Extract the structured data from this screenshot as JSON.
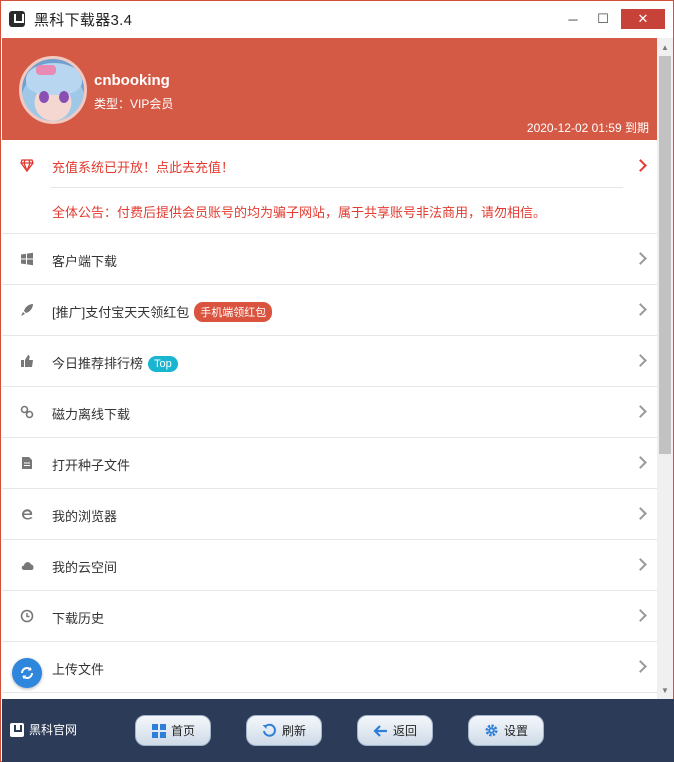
{
  "window": {
    "title": "黑科下载器3.4",
    "controls": {
      "minimize": "─",
      "maximize": "☐",
      "close": "✕"
    }
  },
  "profile": {
    "username": "cnbooking",
    "type": "类型：VIP会员",
    "expire": "2020-12-02 01:59 到期"
  },
  "notice": {
    "recharge": "充值系统已开放！点此去充值！",
    "announcement": "全体公告：付费后提供会员账号的均为骗子网站，属于共享账号非法商用，请勿相信。"
  },
  "menu": [
    {
      "label": "客户端下载",
      "icon": "windows-icon"
    },
    {
      "label": "[推广]支付宝天天领红包",
      "icon": "rocket-icon",
      "badge": "手机端领红包"
    },
    {
      "label": "今日推荐排行榜",
      "icon": "thumbs-up-icon",
      "badge": "Top"
    },
    {
      "label": "磁力离线下载",
      "icon": "link-icon"
    },
    {
      "label": "打开种子文件",
      "icon": "file-icon"
    },
    {
      "label": "我的浏览器",
      "icon": "ie-browser-icon"
    },
    {
      "label": "我的云空间",
      "icon": "cloud-icon"
    },
    {
      "label": "下载历史",
      "icon": "clock-icon"
    },
    {
      "label": "上传文件",
      "icon": "upload-icon"
    }
  ],
  "bottombar": {
    "site": "黑科官网",
    "home": "首页",
    "refresh": "刷新",
    "back": "返回",
    "settings": "设置"
  },
  "colors": {
    "header": "#d45a45",
    "alert": "#e23a2f",
    "bottombar": "#2c3b57",
    "badge_red": "#d9533f",
    "badge_cyan": "#19b6d2"
  }
}
